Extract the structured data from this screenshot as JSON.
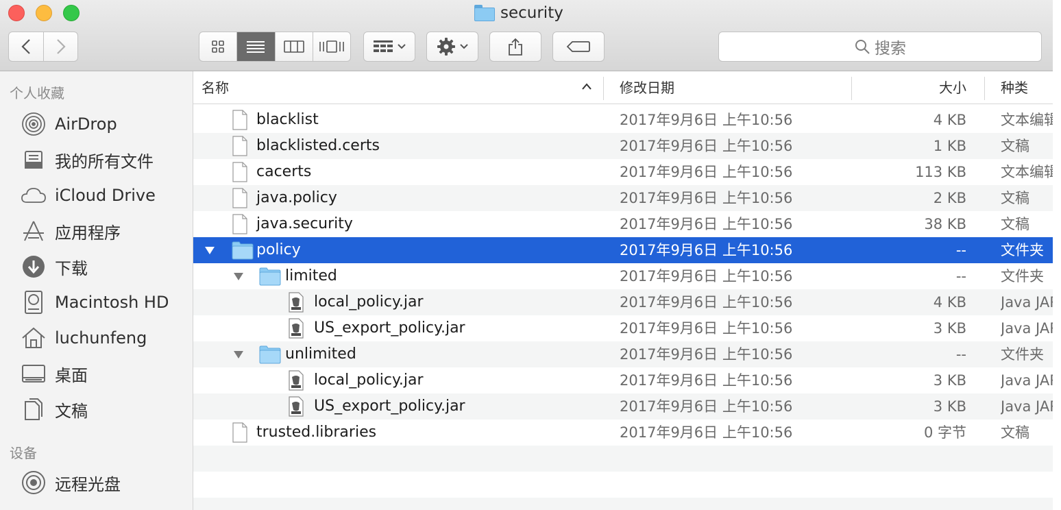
{
  "window": {
    "title": "security"
  },
  "toolbar": {
    "back_icon": "chevron-left-icon",
    "forward_icon": "chevron-right-icon",
    "view_modes": [
      "icon-view",
      "list-view",
      "column-view",
      "cover-flow-view"
    ],
    "active_view": "list-view",
    "arrange_icon": "arrange-grid-icon",
    "action_icon": "gear-icon",
    "share_icon": "share-icon",
    "tag_icon": "tag-icon",
    "search_placeholder": "搜索"
  },
  "sidebar": {
    "favorites_title": "个人收藏",
    "favorites": [
      {
        "label": "AirDrop",
        "icon": "airdrop-icon"
      },
      {
        "label": "我的所有文件",
        "icon": "all-files-icon"
      },
      {
        "label": "iCloud Drive",
        "icon": "cloud-icon"
      },
      {
        "label": "应用程序",
        "icon": "applications-icon"
      },
      {
        "label": "下载",
        "icon": "download-icon"
      },
      {
        "label": "Macintosh HD",
        "icon": "hard-drive-icon"
      },
      {
        "label": "luchunfeng",
        "icon": "home-icon"
      },
      {
        "label": "桌面",
        "icon": "desktop-icon"
      },
      {
        "label": "文稿",
        "icon": "documents-icon"
      }
    ],
    "devices_title": "设备",
    "devices": [
      {
        "label": "远程光盘",
        "icon": "optical-disc-icon"
      }
    ]
  },
  "columns": {
    "name": "名称",
    "date": "修改日期",
    "size": "大小",
    "kind": "种类"
  },
  "files": [
    {
      "name": "blacklist",
      "date": "2017年9月6日 上午10:56",
      "size": "4 KB",
      "kind": "文本编辑",
      "type": "document",
      "level": 0
    },
    {
      "name": "blacklisted.certs",
      "date": "2017年9月6日 上午10:56",
      "size": "1 KB",
      "kind": "文稿",
      "type": "document",
      "level": 0
    },
    {
      "name": "cacerts",
      "date": "2017年9月6日 上午10:56",
      "size": "113 KB",
      "kind": "文本编辑",
      "type": "document",
      "level": 0
    },
    {
      "name": "java.policy",
      "date": "2017年9月6日 上午10:56",
      "size": "2 KB",
      "kind": "文稿",
      "type": "document",
      "level": 0
    },
    {
      "name": "java.security",
      "date": "2017年9月6日 上午10:56",
      "size": "38 KB",
      "kind": "文稿",
      "type": "document",
      "level": 0
    },
    {
      "name": "policy",
      "date": "2017年9月6日 上午10:56",
      "size": "--",
      "kind": "文件夹",
      "type": "folder",
      "level": 0,
      "expanded": true,
      "selected": true
    },
    {
      "name": "limited",
      "date": "2017年9月6日 上午10:56",
      "size": "--",
      "kind": "文件夹",
      "type": "folder",
      "level": 1,
      "expanded": true
    },
    {
      "name": "local_policy.jar",
      "date": "2017年9月6日 上午10:56",
      "size": "4 KB",
      "kind": "Java JAR",
      "type": "jar",
      "level": 2
    },
    {
      "name": "US_export_policy.jar",
      "date": "2017年9月6日 上午10:56",
      "size": "3 KB",
      "kind": "Java JAR",
      "type": "jar",
      "level": 2
    },
    {
      "name": "unlimited",
      "date": "2017年9月6日 上午10:56",
      "size": "--",
      "kind": "文件夹",
      "type": "folder",
      "level": 1,
      "expanded": true
    },
    {
      "name": "local_policy.jar",
      "date": "2017年9月6日 上午10:56",
      "size": "3 KB",
      "kind": "Java JAR",
      "type": "jar",
      "level": 2
    },
    {
      "name": "US_export_policy.jar",
      "date": "2017年9月6日 上午10:56",
      "size": "3 KB",
      "kind": "Java JAR",
      "type": "jar",
      "level": 2
    },
    {
      "name": "trusted.libraries",
      "date": "2017年9月6日 上午10:56",
      "size": "0 字节",
      "kind": "文稿",
      "type": "document",
      "level": 0
    }
  ],
  "colors": {
    "selection": "#2162d8",
    "stripe": "#f4f5f5",
    "folder": "#8ccbf3"
  }
}
